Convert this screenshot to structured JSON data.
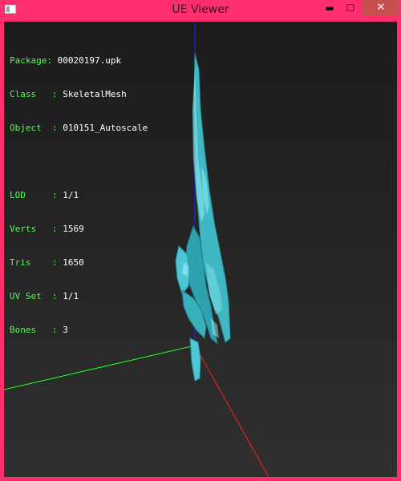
{
  "window": {
    "title": "UE Viewer",
    "controls": {
      "minimize": "▬",
      "maximize": "☐",
      "close": "✕"
    }
  },
  "info": {
    "package": {
      "label": "Package",
      "value": "00020197.upk"
    },
    "class": {
      "label": "Class",
      "value": "SkeletalMesh"
    },
    "object": {
      "label": "Object",
      "value": "010151_Autoscale"
    },
    "lod": {
      "label": "LOD",
      "value": "1/1"
    },
    "verts": {
      "label": "Verts",
      "value": "1569"
    },
    "tris": {
      "label": "Tris",
      "value": "1650"
    },
    "uvset": {
      "label": "UV Set",
      "value": "1/1"
    },
    "bones": {
      "label": "Bones",
      "value": "3"
    }
  },
  "colors": {
    "frame": "#ff2f6f",
    "label": "#4cff4c",
    "value": "#ffffff",
    "axis_x": "#ff2020",
    "axis_y": "#20ff20",
    "axis_z": "#2020ff",
    "mesh": "#3fb8c4"
  }
}
